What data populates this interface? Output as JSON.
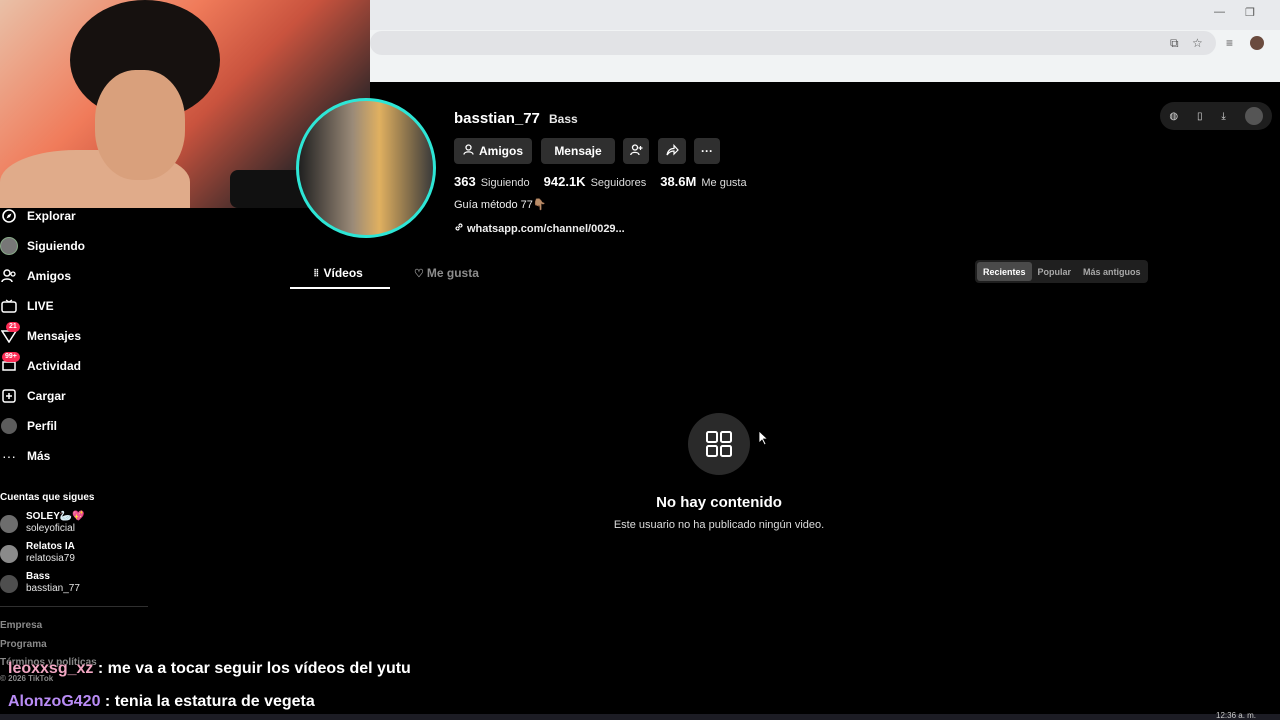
{
  "profile": {
    "username": "basstian_77",
    "nickname": "Bass",
    "buttons": {
      "friends": "Amigos",
      "message": "Mensaje",
      "more": "···"
    },
    "stats": [
      {
        "value": "363",
        "label": "Siguiendo"
      },
      {
        "value": "942.1K",
        "label": "Seguidores"
      },
      {
        "value": "38.6M",
        "label": "Me gusta"
      }
    ],
    "bio": "Guía método 77👇🏽",
    "link": "whatsapp.com/channel/0029..."
  },
  "sidebar": {
    "items": [
      {
        "label": "Explorar",
        "icon": "compass-icon"
      },
      {
        "label": "Siguiendo",
        "icon": "following-avatar-icon"
      },
      {
        "label": "Amigos",
        "icon": "friends-icon"
      },
      {
        "label": "LIVE",
        "icon": "live-tv-icon"
      },
      {
        "label": "Mensajes",
        "icon": "messages-icon",
        "badge": "21"
      },
      {
        "label": "Actividad",
        "icon": "activity-icon",
        "badge": "99+"
      },
      {
        "label": "Cargar",
        "icon": "upload-icon"
      },
      {
        "label": "Perfil",
        "icon": "profile-avatar-icon"
      },
      {
        "label": "Más",
        "icon": "more-dots-icon"
      }
    ],
    "following_title": "Cuentas que sigues",
    "following": [
      {
        "name": "SOLEY🦢💖",
        "handle": "soleyoficial"
      },
      {
        "name": "Relatos IA",
        "handle": "relatosia79"
      },
      {
        "name": "Bass",
        "handle": "basstian_77"
      }
    ],
    "footer": [
      "Empresa",
      "Programa",
      "Términos y políticas",
      "© 2026 TikTok"
    ]
  },
  "tabs": {
    "videos": "Vídeos",
    "likes": "Me gusta"
  },
  "sort": [
    "Recientes",
    "Popular",
    "Más antiguos"
  ],
  "empty_state": {
    "title": "No hay contenido",
    "description": "Este usuario no ha publicado ningún video."
  },
  "chat": [
    {
      "user": "leoxxsg_xz",
      "message": " : me va a tocar seguir los vídeos del yutu"
    },
    {
      "user": "AlonzoG420",
      "message": " : tenia la estatura de vegeta"
    }
  ],
  "system": {
    "clock": "12:36 a. m."
  },
  "colors": {
    "accent": "#fe2c55",
    "avatar_ring": "#2ee6d6",
    "background": "#000000"
  }
}
